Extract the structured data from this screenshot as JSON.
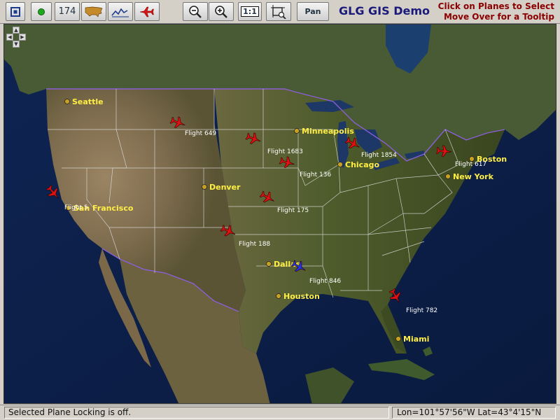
{
  "toolbar": {
    "plane_count": "174",
    "zoom_reset_label": "1:1",
    "pan_label": "Pan",
    "title": "GLG GIS Demo",
    "hint_line1": "Click on Planes to Select",
    "hint_line2": "Move Over for a Tooltip",
    "icons": [
      "frame-icon",
      "green-dot-icon",
      "usa-map-icon",
      "chart-icon",
      "plane-icon",
      "zoom-out-icon",
      "zoom-in-icon",
      "zoom-rect-icon"
    ]
  },
  "map": {
    "cities": [
      {
        "name": "Seattle"
      },
      {
        "name": "Minneapolis"
      },
      {
        "name": "Chicago"
      },
      {
        "name": "Boston"
      },
      {
        "name": "New York"
      },
      {
        "name": "Denver"
      },
      {
        "name": "San Francisco"
      },
      {
        "name": "Dallas"
      },
      {
        "name": "Houston"
      },
      {
        "name": "Miami"
      }
    ],
    "flights": [
      {
        "label": "Flight 649",
        "color": "#dd1111"
      },
      {
        "label": "Flight 1683",
        "color": "#dd1111"
      },
      {
        "label": "Flight 1854",
        "color": "#dd1111"
      },
      {
        "label": "Flight 136",
        "color": "#dd1111"
      },
      {
        "label": "Flight 175",
        "color": "#dd1111"
      },
      {
        "label": "Flight 188",
        "color": "#dd1111"
      },
      {
        "label": "Flight 846",
        "color": "#2233dd"
      },
      {
        "label": "Flight 782",
        "color": "#dd1111"
      },
      {
        "label": "Flight 617",
        "color": "#dd1111"
      },
      {
        "label": "Flight 5",
        "color": "#dd1111"
      }
    ]
  },
  "status": {
    "message": "Selected Plane Locking is off.",
    "coordinates": "Lon=101°57'56\"W  Lat=43°4'15\"N"
  }
}
